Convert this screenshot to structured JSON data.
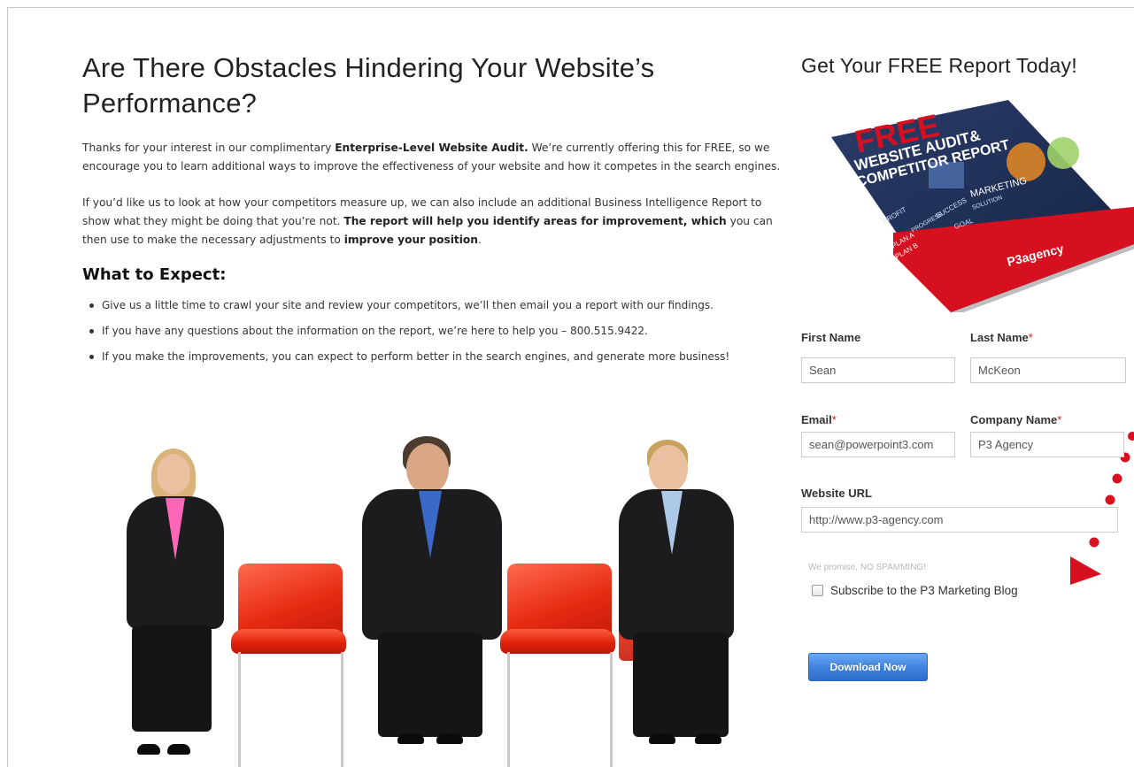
{
  "main": {
    "headline": "Are There Obstacles Hindering Your Website’s Performance?",
    "intro": {
      "p1_a": "Thanks for your interest in our complimentary ",
      "p1_b": "Enterprise-Level Website Audit.",
      "p1_c": " We’re currently offering this for FREE, so we encourage you to learn additional ways to improve the effectiveness of your website and how it competes in the search engines.",
      "p2_a": "If you’d like us to look at how your competitors measure up, we can also include an additional Business Intelligence Report to show what they might be doing that you’re not. ",
      "p2_b": "The report will help you identify areas for improvement, which",
      "p2_c": " you can then use to make the necessary adjustments to ",
      "p2_d": "improve your position",
      "p2_e": "."
    },
    "expect_heading": "What to Expect:",
    "bullets": [
      "Give us a little time to crawl your site and review your competitors, we’ll then email you a report with our findings.",
      "If you have any questions about the information on the report, we’re here to help you – 800.515.9422.",
      "If you make the improvements, you can expect to perform better in the search engines, and generate more business!"
    ]
  },
  "sidebar": {
    "title": "Get Your FREE Report Today!",
    "report_cover": {
      "free": "FREE",
      "line1": "WEBSITE AUDIT&",
      "line2": "COMPETITOR REPORT",
      "brand": "P3agency",
      "words": [
        "MARKETING",
        "PROFIT",
        "SUCCESS",
        "PLAN A",
        "PLAN B",
        "GOAL",
        "SOLUTION",
        "PROGRESS"
      ]
    },
    "form": {
      "first_name_label": "First Name",
      "first_name_value": "Sean",
      "last_name_label": "Last Name",
      "last_name_value": "McKeon",
      "email_label": "Email",
      "email_value": "sean@powerpoint3.com",
      "company_label": "Company Name",
      "company_value": "P3 Agency",
      "url_label": "Website URL",
      "url_value": "http://www.p3-agency.com",
      "required_mark": "*",
      "nospam": "We promise, NO SPAMMING!",
      "subscribe_label": "Subscribe to the P3 Marketing Blog",
      "subscribe_checked": false,
      "submit_label": "Download Now"
    }
  },
  "colors": {
    "accent_red": "#d7101f",
    "button_blue": "#3d80dd",
    "required_red": "#cc2222"
  }
}
